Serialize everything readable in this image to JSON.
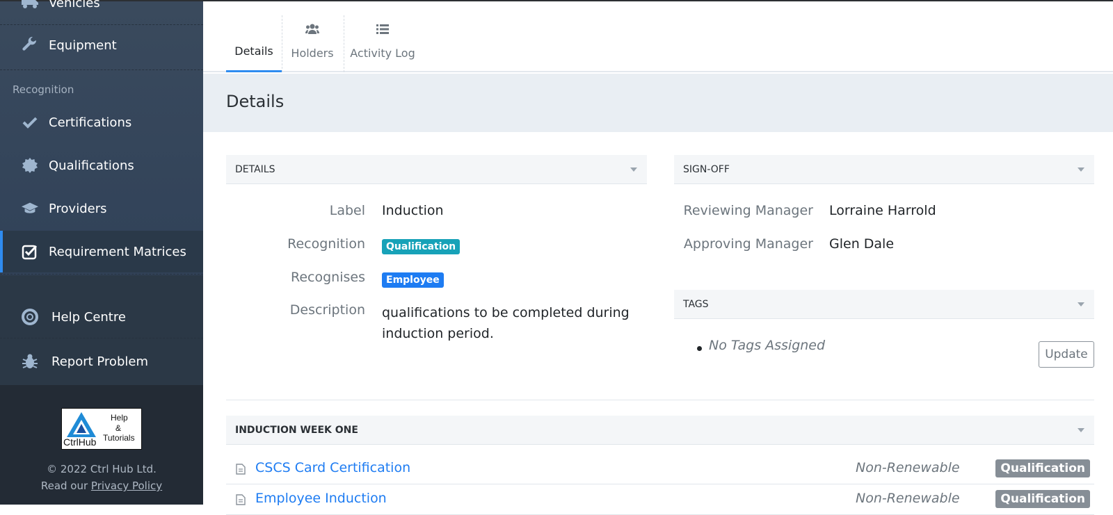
{
  "sidebar": {
    "items": [
      {
        "label": "Vehicles",
        "icon": "truck-icon"
      },
      {
        "label": "Equipment",
        "icon": "wrench-icon"
      },
      {
        "label": "Certifications",
        "icon": "check-icon"
      },
      {
        "label": "Qualifications",
        "icon": "certificate-icon"
      },
      {
        "label": "Providers",
        "icon": "graduation-cap-icon"
      },
      {
        "label": "Requirement Matrices",
        "icon": "checked-box-icon"
      }
    ],
    "section_recognition": "Recognition",
    "help_centre": "Help Centre",
    "report_problem": "Report Problem",
    "logo": {
      "brand": "CtrlHub",
      "line1": "Help",
      "line2": "&",
      "line3": "Tutorials"
    },
    "copyright": "© 2022 Ctrl Hub Ltd.",
    "read_our": "Read our ",
    "privacy_policy": "Privacy Policy"
  },
  "tabs": [
    {
      "label": "Details",
      "icon": "",
      "active": true
    },
    {
      "label": "Holders",
      "icon": "users-icon",
      "active": false
    },
    {
      "label": "Activity Log",
      "icon": "list-icon",
      "active": false
    }
  ],
  "page_title": "Details",
  "details_panel": {
    "heading": "DETAILS",
    "rows": [
      {
        "label": "Label",
        "value": "Induction"
      },
      {
        "label": "Recognition",
        "badge": "Qualification"
      },
      {
        "label": "Recognises",
        "badge": "Employee"
      },
      {
        "label": "Description",
        "value_line1": "qualifications to be completed during",
        "value_line2": "induction period."
      }
    ]
  },
  "signoff_panel": {
    "heading": "SIGN-OFF",
    "rows": [
      {
        "label": "Reviewing Manager",
        "value": "Lorraine Harrold"
      },
      {
        "label": "Approving Manager",
        "value": "Glen Dale"
      }
    ]
  },
  "tags_panel": {
    "heading": "TAGS",
    "empty_text": "No Tags Assigned",
    "update_label": "Update"
  },
  "induction_week": {
    "heading": "INDUCTION WEEK ONE",
    "items": [
      {
        "name": "CSCS Card Certification",
        "renewal": "Non-Renewable",
        "type": "Qualification"
      },
      {
        "name": "Employee Induction",
        "renewal": "Non-Renewable",
        "type": "Qualification"
      }
    ]
  },
  "colors": {
    "accent": "#2f8cf0",
    "sidebar": "#33445a",
    "teal_badge": "#17a2b8",
    "blue_badge": "#1e7cf2",
    "gray_badge": "#868e96"
  }
}
